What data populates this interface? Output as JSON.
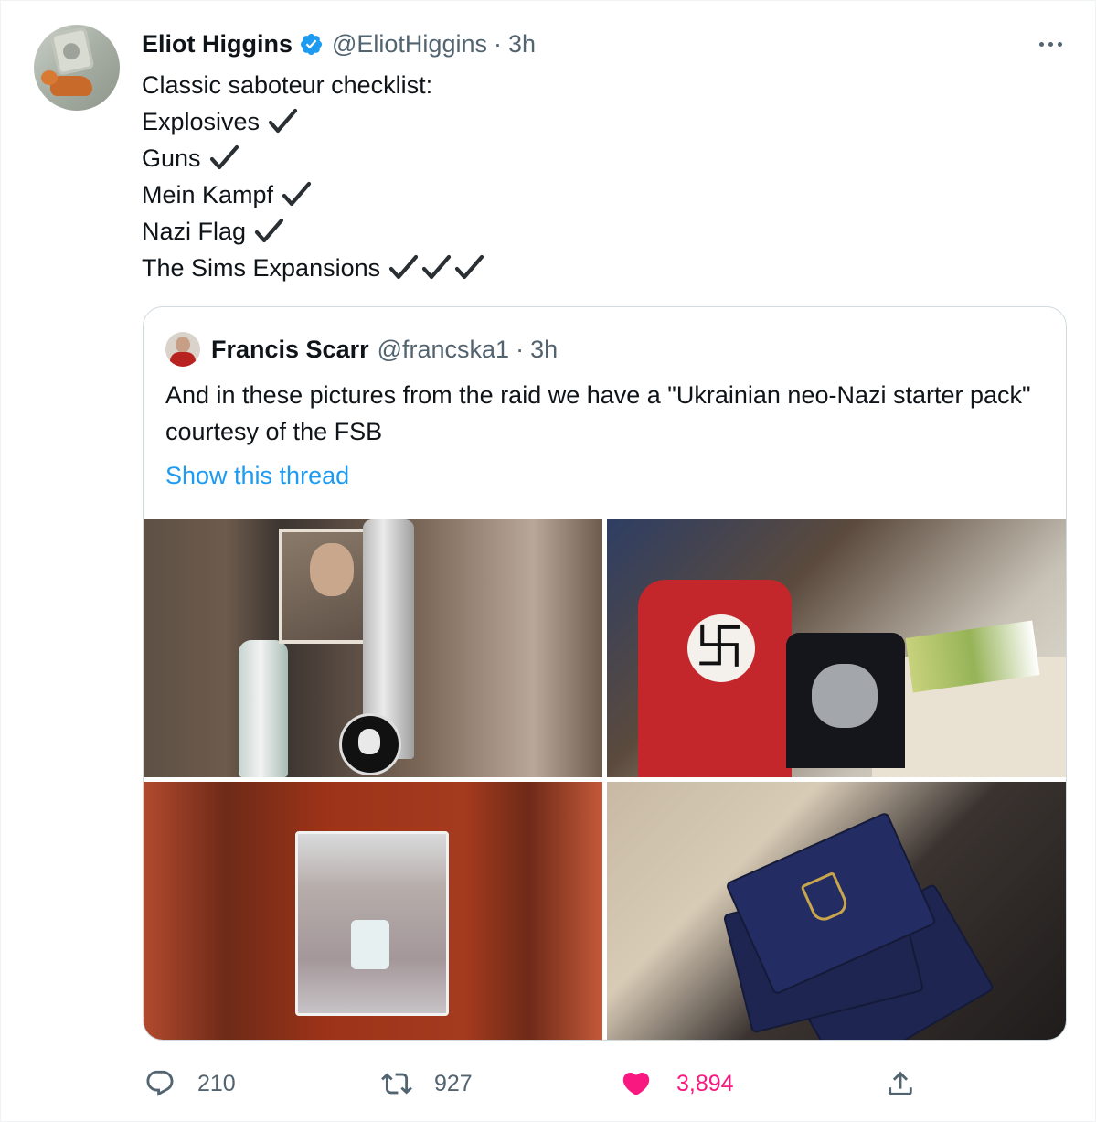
{
  "tweet": {
    "author": {
      "display_name": "Eliot Higgins",
      "handle": "@EliotHiggins",
      "time": "3h",
      "verified": true,
      "separator": "·"
    },
    "lines": [
      {
        "text": "Classic saboteur checklist:",
        "checks": 0
      },
      {
        "text": "Explosives",
        "checks": 1
      },
      {
        "text": "Guns",
        "checks": 1
      },
      {
        "text": "Mein Kampf",
        "checks": 1
      },
      {
        "text": "Nazi Flag",
        "checks": 1
      },
      {
        "text": "The Sims Expansions",
        "checks": 3
      }
    ]
  },
  "quoted_tweet": {
    "author": {
      "display_name": "Francis Scarr",
      "handle": "@francska1",
      "time": "3h",
      "separator": "·"
    },
    "text": "And in these pictures from the raid we have a \"Ukrainian neo-Nazi starter pack\" courtesy of the FSB",
    "show_thread_label": "Show this thread",
    "media_count": 4
  },
  "actions": {
    "reply_count": "210",
    "retweet_count": "927",
    "like_count": "3,894",
    "liked": true
  },
  "colors": {
    "accent": "#1d9bf0",
    "like": "#f91880",
    "secondary_text": "#536471",
    "border": "#cfd9de"
  },
  "icons": {
    "verified": "verified-badge-icon",
    "more": "more-dots-icon",
    "check": "heavy-check-icon",
    "reply": "reply-bubble-icon",
    "retweet": "retweet-icon",
    "like": "heart-filled-icon",
    "share": "share-upload-icon"
  }
}
